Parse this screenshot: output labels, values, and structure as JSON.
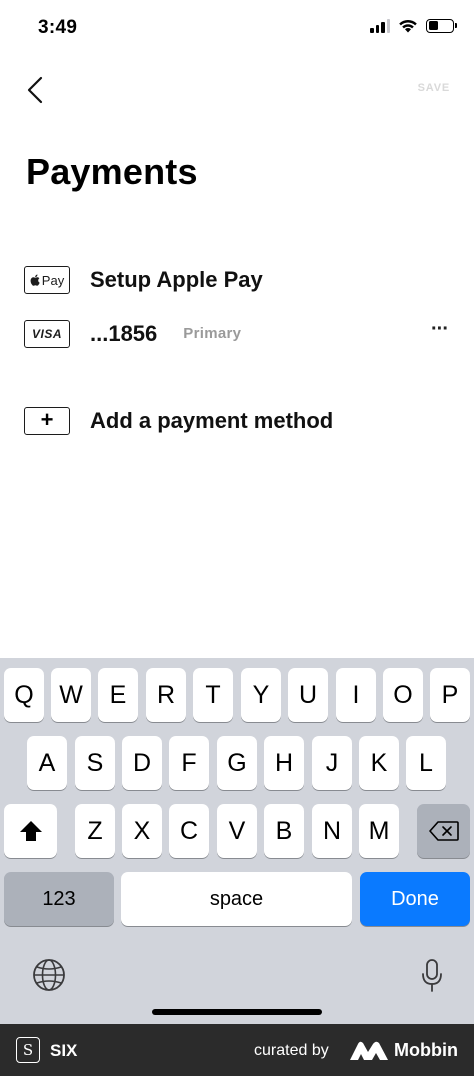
{
  "status_bar": {
    "time": "3:49",
    "icons": [
      "cellular-signal-icon",
      "wifi-icon",
      "battery-icon"
    ]
  },
  "nav": {
    "back_icon": "chevron-left-icon",
    "save_label": "SAVE"
  },
  "page_title": "Payments",
  "payments": [
    {
      "icon": "apple-pay-icon",
      "icon_text": "Pay",
      "label": "Setup Apple Pay"
    },
    {
      "icon": "visa-icon",
      "icon_text": "VISA",
      "label": "...1856",
      "badge": "Primary",
      "more_label": "···"
    },
    {
      "icon": "plus-icon",
      "icon_text": "+",
      "label": "Add a payment method"
    }
  ],
  "keyboard": {
    "row1": [
      "Q",
      "W",
      "E",
      "R",
      "T",
      "Y",
      "U",
      "I",
      "O",
      "P"
    ],
    "row2": [
      "A",
      "S",
      "D",
      "F",
      "G",
      "H",
      "J",
      "K",
      "L"
    ],
    "row3": [
      "Z",
      "X",
      "C",
      "V",
      "B",
      "N",
      "M"
    ],
    "shift_icon": "shift-arrow-icon",
    "delete_icon": "backspace-icon",
    "numbers_label": "123",
    "space_label": "space",
    "done_label": "Done",
    "globe_icon": "globe-icon",
    "mic_icon": "microphone-icon",
    "accent_color": "#0a7aff"
  },
  "footer": {
    "app_name": "SIX",
    "app_logo": "S",
    "curated_by": "curated by",
    "brand": "Mobbin"
  }
}
